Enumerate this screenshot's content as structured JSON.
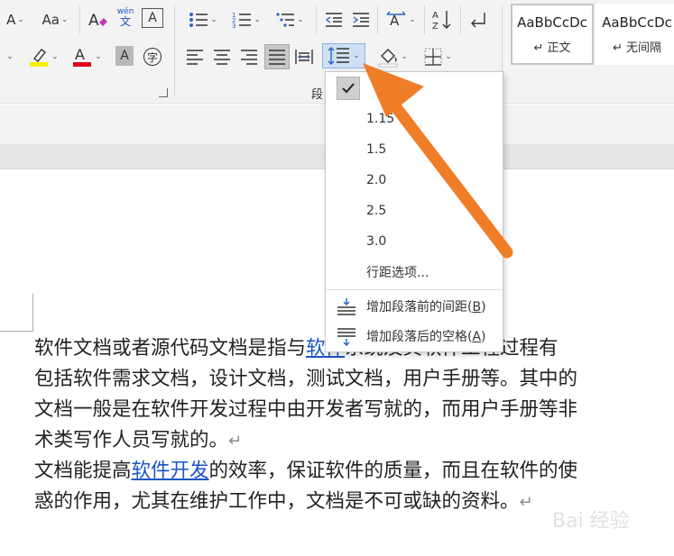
{
  "ribbon": {
    "font_size_label": "A",
    "change_case_label": "Aa",
    "phonetic_top": "wén",
    "phonetic_bottom": "文",
    "char_border_label": "A",
    "font_color_label": "A",
    "char_shade_label": "A",
    "enclose_label": "字",
    "sort_label": "A↓Z",
    "group_label": "段",
    "highlight_color": "#f5f000",
    "font_color": "#e0001a"
  },
  "styles": [
    {
      "sample": "AaBbCcDc",
      "name": "↵ 正文"
    },
    {
      "sample": "AaBbCcDc",
      "name": "↵ 无间隔"
    }
  ],
  "menu": {
    "items": [
      {
        "label": "1.0",
        "checked": true
      },
      {
        "label": "1.15"
      },
      {
        "label": "1.5"
      },
      {
        "label": "2.0"
      },
      {
        "label": "2.5"
      },
      {
        "label": "3.0"
      }
    ],
    "options_label": "行距选项...",
    "add_before_label": "增加段落前的间距(",
    "add_before_key": "B",
    "add_after_label": "增加段落后的空格(",
    "add_after_key": "A",
    "close_paren": ")"
  },
  "document": {
    "l1a": "软件文档或者源代码文档是指与",
    "l1link": "软件",
    "l1b": "系统及其软件工程过程有",
    "l2": "包括软件需求文档，设计文档，测试文档，用户手册等。其中的",
    "l3": "文档一般是在软件开发过程中由开发者写就的，而用户手册等非",
    "l4": "术类写作人员写就的。",
    "l5a": "文档能提高",
    "l5link": "软件开发",
    "l5b": "的效率，保证软件的质量，而且在软件的使",
    "l6": "惑的作用，尤其在维护工作中，文档是不可或缺的资料。",
    "pilcrow": "↵"
  },
  "annotation": {
    "arrow_color": "#f07d28"
  },
  "watermark": "Bai 经验"
}
